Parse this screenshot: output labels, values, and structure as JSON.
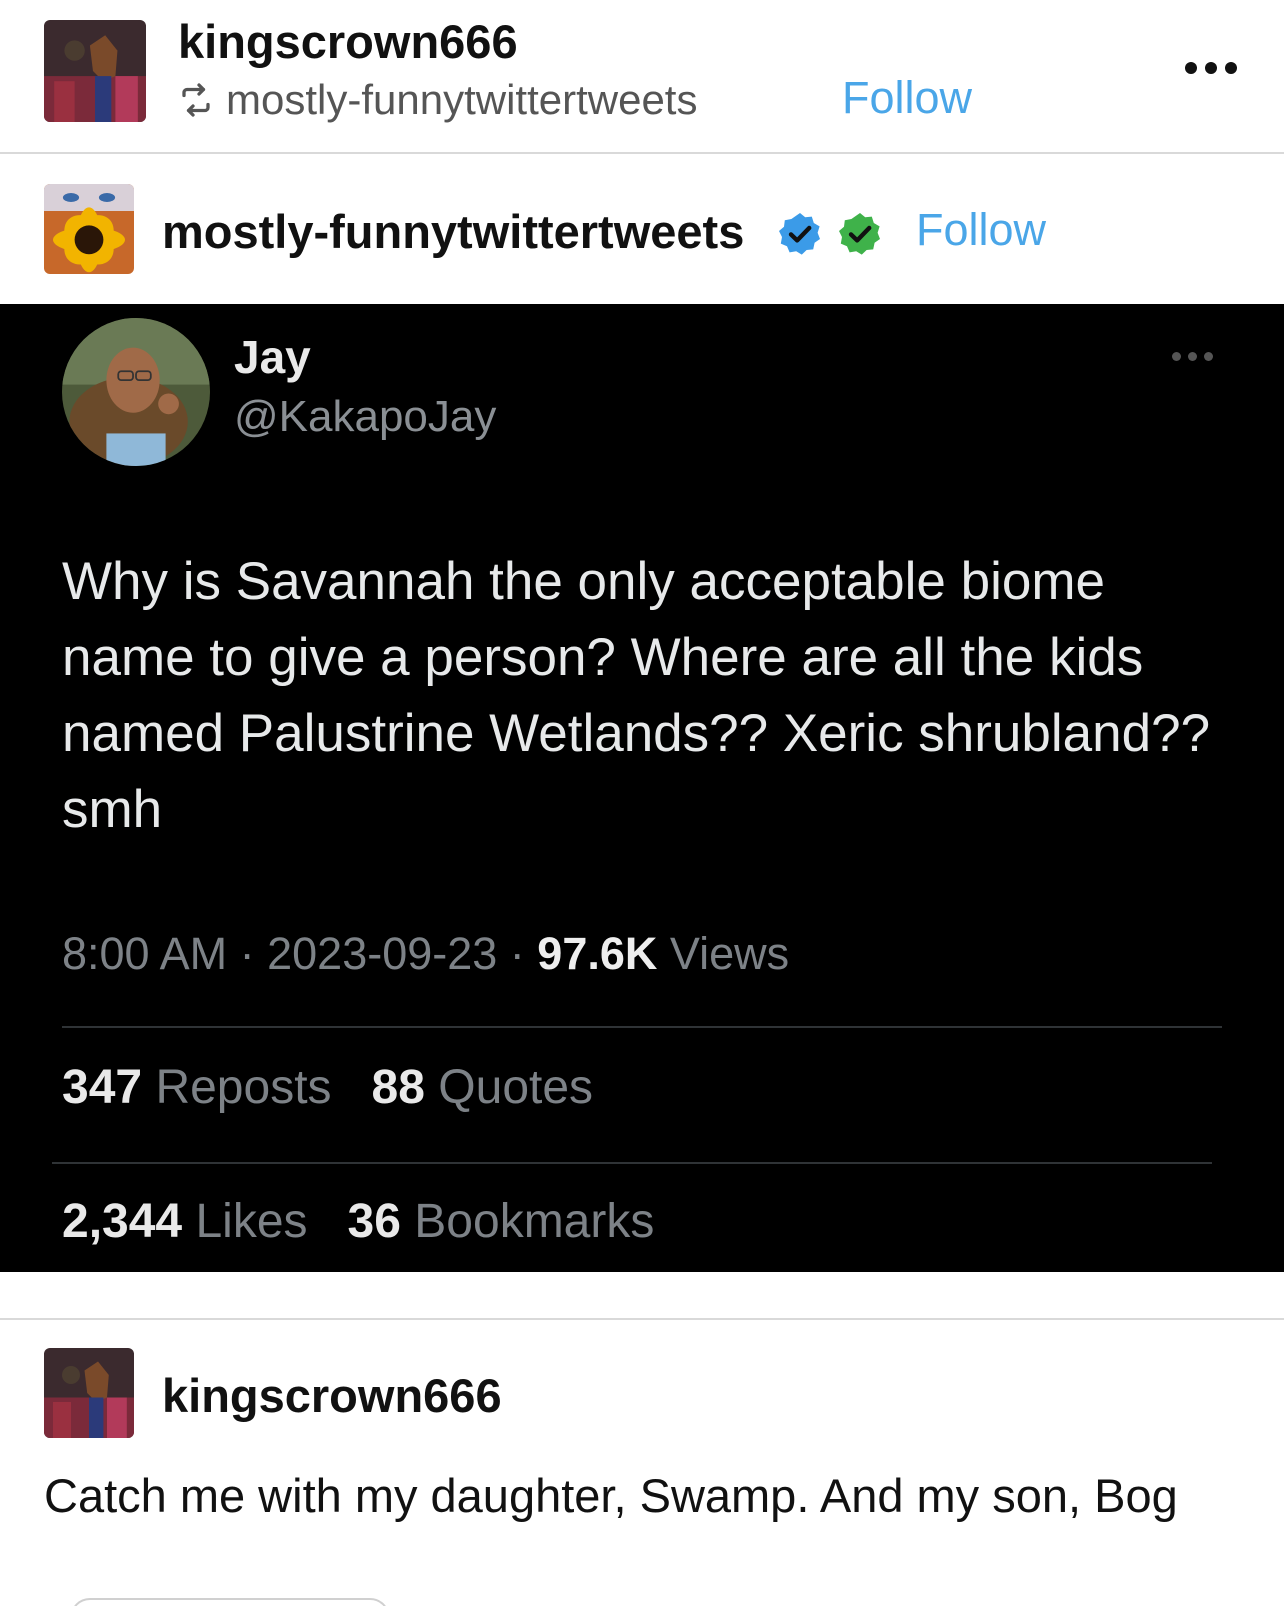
{
  "post": {
    "reblogger": "kingscrown666",
    "reblogged_from": "mostly-funnytwittertweets",
    "follow_label": "Follow",
    "more_icon": "more-dots-icon"
  },
  "original": {
    "author": "mostly-funnytwittertweets",
    "follow_label": "Follow",
    "badges": [
      "verified-blue-icon",
      "verified-green-icon"
    ]
  },
  "tweet": {
    "name": "Jay",
    "handle": "@KakapoJay",
    "text": "Why is Savannah the only acceptable biome name to give a person? Where are all the kids named Palustrine Wetlands?? Xeric shrubland?? smh",
    "time": "8:00 AM",
    "date": "2023-09-23",
    "views_count": "97.6K",
    "views_label": "Views",
    "reposts_count": "347",
    "reposts_label": "Reposts",
    "quotes_count": "88",
    "quotes_label": "Quotes",
    "likes_count": "2,344",
    "likes_label": "Likes",
    "bookmarks_count": "36",
    "bookmarks_label": "Bookmarks"
  },
  "reply": {
    "author": "kingscrown666",
    "text": "Catch me with my daughter, Swamp. And my son, Bog"
  },
  "colors": {
    "follow": "#4aa6e8",
    "tweet_bg": "#000000",
    "verified_blue": "#3b9be8",
    "verified_green": "#3fb24a"
  }
}
